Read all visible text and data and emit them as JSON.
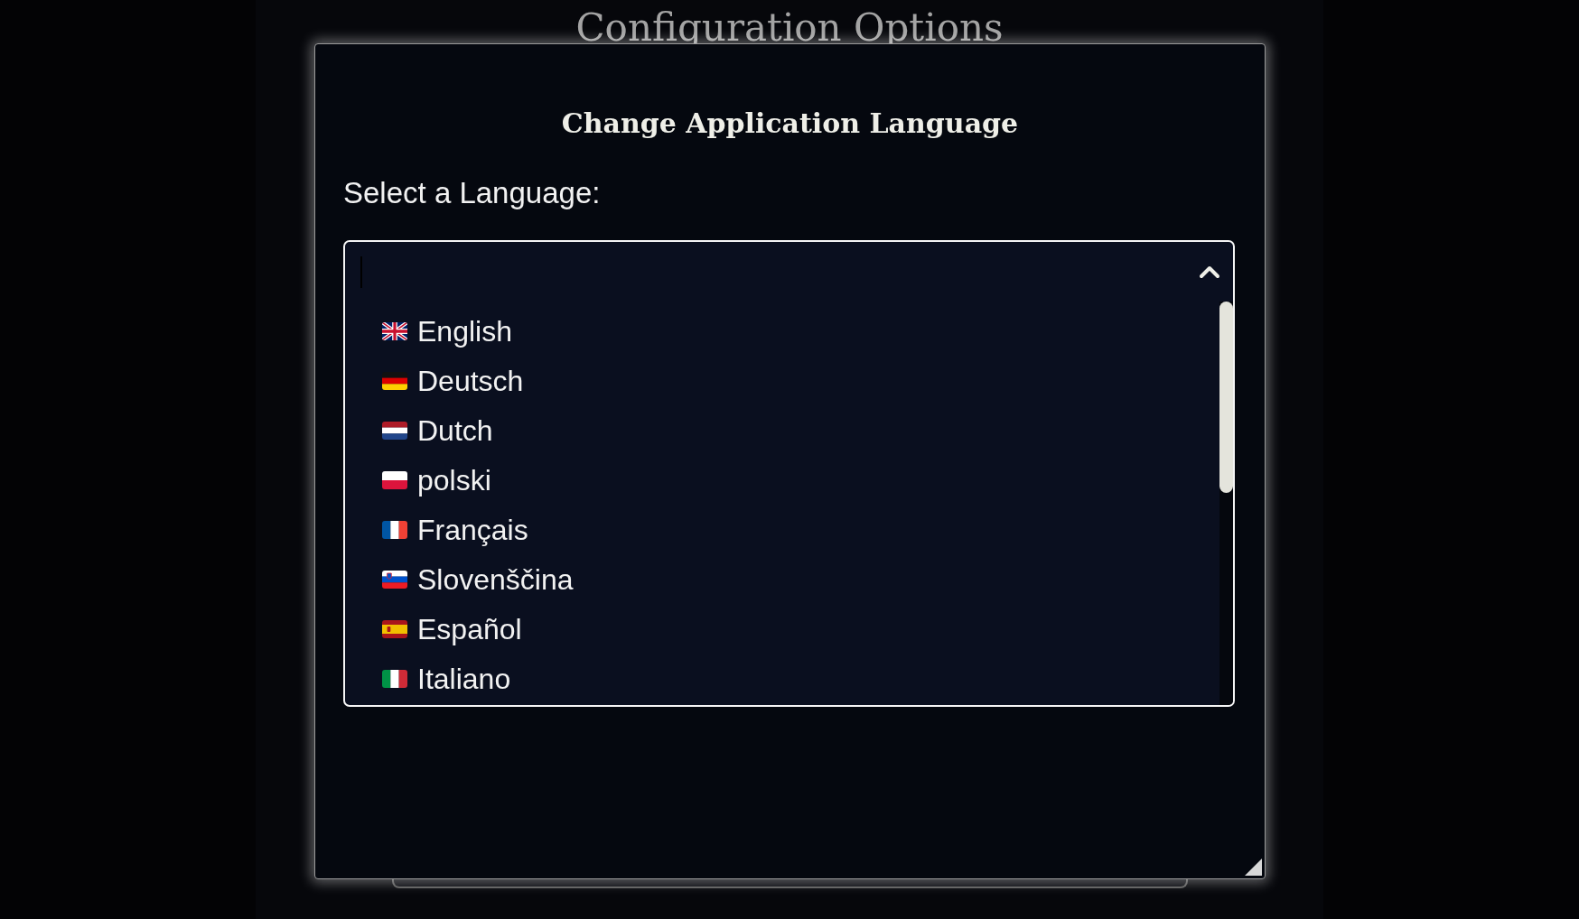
{
  "page": {
    "title": "Configuration Options"
  },
  "dialog": {
    "title": "Change Application Language",
    "label": "Select a Language:",
    "language_select": {
      "expanded": true,
      "options": [
        {
          "label": "English",
          "kind": "gb",
          "selected": false
        },
        {
          "label": "Deutsch",
          "kind": "de",
          "selected": false
        },
        {
          "label": "Dutch",
          "kind": "nl",
          "selected": false
        },
        {
          "label": "polski",
          "kind": "pl",
          "selected": false
        },
        {
          "label": "Français",
          "kind": "fr",
          "selected": false
        },
        {
          "label": "Slovenščina",
          "kind": "si",
          "selected": false
        },
        {
          "label": "Español",
          "kind": "es",
          "selected": false
        },
        {
          "label": "Italiano",
          "kind": "it",
          "selected": false
        }
      ]
    }
  }
}
